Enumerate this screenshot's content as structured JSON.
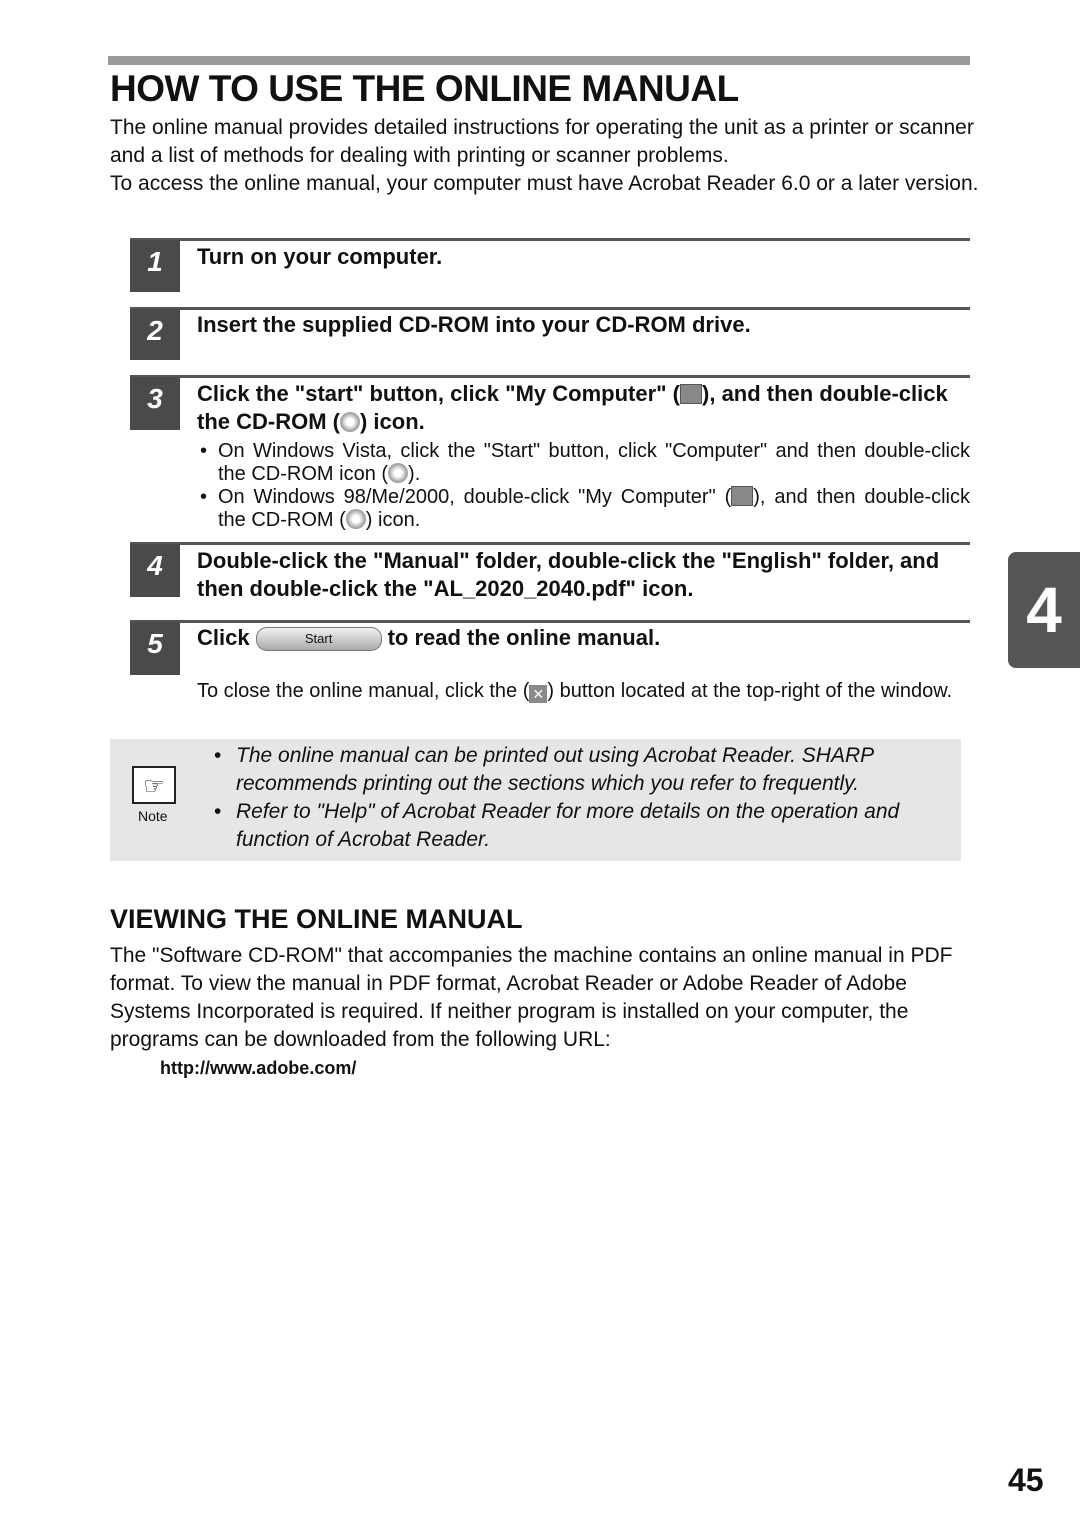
{
  "title": "HOW TO USE THE ONLINE MANUAL",
  "intro": [
    "The online manual provides detailed instructions for operating the unit as a printer or scanner and a list of methods for dealing with printing or scanner problems.",
    "To access the online manual, your computer must have Acrobat Reader 6.0 or a later version."
  ],
  "steps": [
    {
      "num": "1",
      "text": "Turn on your computer."
    },
    {
      "num": "2",
      "text": "Insert the supplied CD-ROM into your CD-ROM drive."
    },
    {
      "num": "3",
      "text_a": "Click the \"start\" button, click \"My Computer\" (",
      "text_b": "), and then double-click the CD-ROM (",
      "text_c": ") icon.",
      "bullets": [
        {
          "a": "On Windows Vista, click the \"Start\" button, click \"Computer\" and then double-click the CD-ROM icon (",
          "b": ")."
        },
        {
          "a": "On Windows 98/Me/2000, double-click \"My Computer\" (",
          "b": "), and then double-click the CD-ROM (",
          "c": ") icon."
        }
      ]
    },
    {
      "num": "4",
      "text": "Double-click the \"Manual\" folder, double-click the \"English\" folder, and then double-click the \"AL_2020_2040.pdf\" icon."
    },
    {
      "num": "5",
      "text_a": "Click",
      "button": "Start",
      "text_b": "to read the online manual.",
      "close_a": "To close the online manual, click the (",
      "close_icon": "✕",
      "close_b": ") button located at the top-right of the window."
    }
  ],
  "note": {
    "label": "Note",
    "icon": "pointing-hand-icon",
    "items": [
      "The online manual can be printed out using Acrobat Reader. SHARP recommends printing out the sections which you refer to frequently.",
      "Refer to \"Help\" of Acrobat Reader for more details on the operation and function of Acrobat Reader."
    ]
  },
  "section2": {
    "title": "VIEWING THE ONLINE MANUAL",
    "text": "The \"Software CD-ROM\" that accompanies the machine contains an online manual in PDF format. To view the manual in PDF format, Acrobat Reader or Adobe Reader of Adobe Systems Incorporated is required. If neither program is installed on your computer, the programs can be downloaded from the following URL:",
    "url": "http://www.adobe.com/"
  },
  "chapter_tab": "4",
  "page_number": "45"
}
